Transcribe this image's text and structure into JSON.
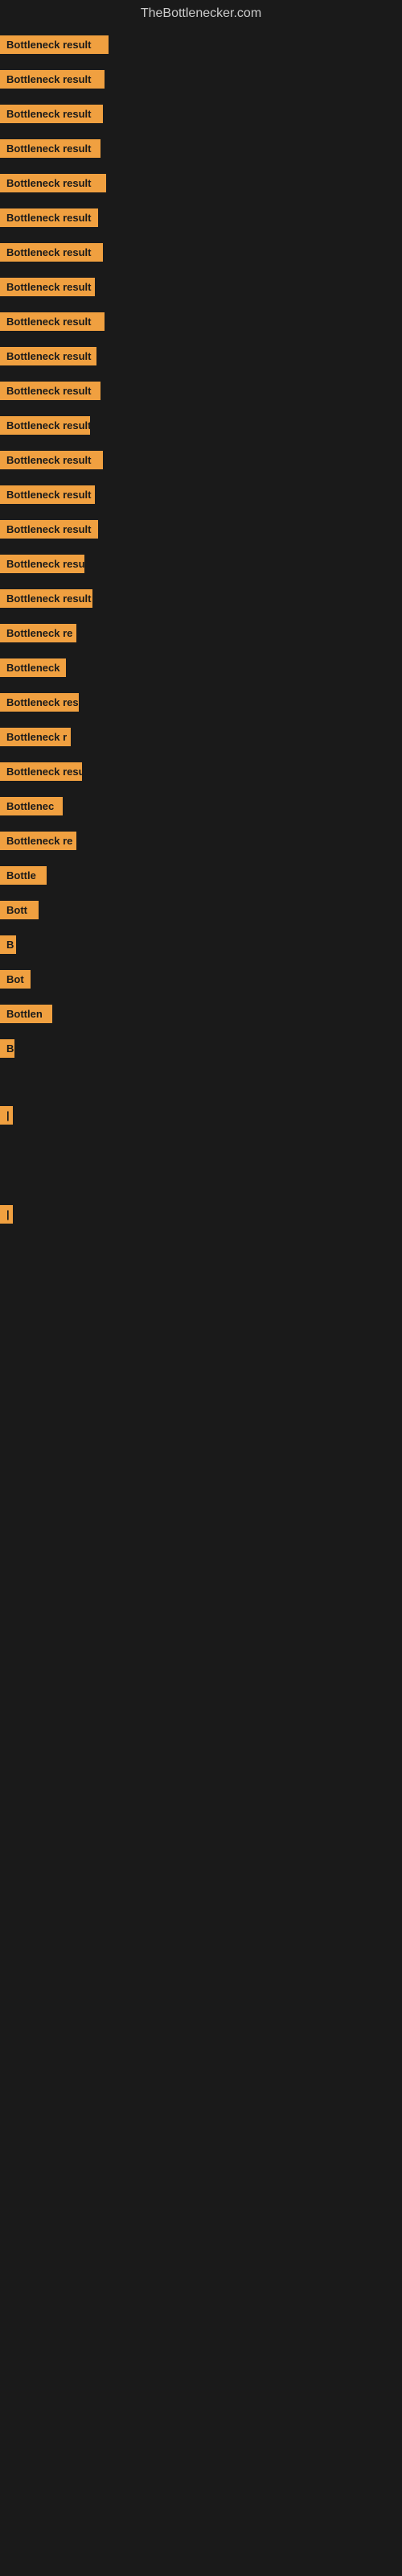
{
  "site": {
    "title": "TheBottlenecker.com"
  },
  "bars": [
    {
      "label": "Bottleneck result",
      "width": 135
    },
    {
      "label": "Bottleneck result",
      "width": 130
    },
    {
      "label": "Bottleneck result",
      "width": 128
    },
    {
      "label": "Bottleneck result",
      "width": 125
    },
    {
      "label": "Bottleneck result",
      "width": 132
    },
    {
      "label": "Bottleneck result",
      "width": 122
    },
    {
      "label": "Bottleneck result",
      "width": 128
    },
    {
      "label": "Bottleneck result",
      "width": 118
    },
    {
      "label": "Bottleneck result",
      "width": 130
    },
    {
      "label": "Bottleneck result",
      "width": 120
    },
    {
      "label": "Bottleneck result",
      "width": 125
    },
    {
      "label": "Bottleneck result",
      "width": 112
    },
    {
      "label": "Bottleneck result",
      "width": 128
    },
    {
      "label": "Bottleneck result",
      "width": 118
    },
    {
      "label": "Bottleneck result",
      "width": 122
    },
    {
      "label": "Bottleneck resu",
      "width": 105
    },
    {
      "label": "Bottleneck result",
      "width": 115
    },
    {
      "label": "Bottleneck re",
      "width": 95
    },
    {
      "label": "Bottleneck",
      "width": 82
    },
    {
      "label": "Bottleneck res",
      "width": 98
    },
    {
      "label": "Bottleneck r",
      "width": 88
    },
    {
      "label": "Bottleneck resu",
      "width": 102
    },
    {
      "label": "Bottlenec",
      "width": 78
    },
    {
      "label": "Bottleneck re",
      "width": 95
    },
    {
      "label": "Bottle",
      "width": 58
    },
    {
      "label": "Bott",
      "width": 48
    },
    {
      "label": "B",
      "width": 20
    },
    {
      "label": "Bot",
      "width": 38
    },
    {
      "label": "Bottlen",
      "width": 65
    },
    {
      "label": "B",
      "width": 18
    },
    {
      "label": "",
      "width": 0
    },
    {
      "label": "",
      "width": 0
    },
    {
      "label": "|",
      "width": 10
    },
    {
      "label": "",
      "width": 0
    },
    {
      "label": "",
      "width": 0
    },
    {
      "label": "",
      "width": 0
    },
    {
      "label": "",
      "width": 0
    },
    {
      "label": "|",
      "width": 10
    }
  ]
}
